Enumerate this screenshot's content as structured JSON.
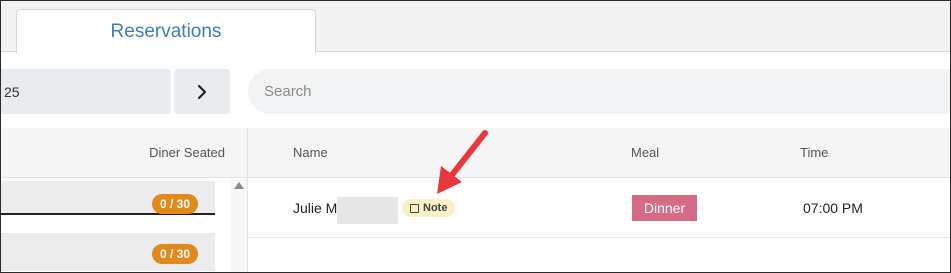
{
  "tabs": [
    {
      "label": "Reservations",
      "active": true
    }
  ],
  "toolbar": {
    "date_value": "25",
    "next_icon": "chevron-right-icon",
    "search_placeholder": "Search"
  },
  "left_panel": {
    "header_label": "Diner Seated",
    "slots": [
      {
        "badge": "0 / 30"
      },
      {
        "badge": "0 / 30"
      }
    ]
  },
  "table": {
    "columns": [
      "Name",
      "Meal",
      "Time"
    ],
    "rows": [
      {
        "name": "Julie M",
        "note_label": "Note",
        "meal": "Dinner",
        "time": "07:00 PM"
      }
    ]
  },
  "colors": {
    "tab_text": "#3d7fb6",
    "capacity_badge": "#e2891c",
    "meal_dinner": "#d66b85",
    "note_chip": "#fbf1c7",
    "annotation_arrow": "#e8383d"
  }
}
